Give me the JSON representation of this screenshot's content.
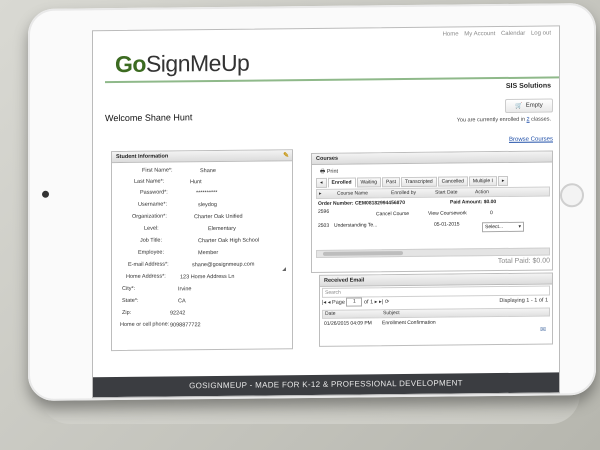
{
  "topnav": {
    "home": "Home",
    "my_account": "My Account",
    "calendar": "Calendar",
    "logout": "Log out"
  },
  "logo": {
    "go": "Go",
    "rest": "SignMeUp"
  },
  "org_name": "SIS Solutions",
  "cart": {
    "label": "Empty"
  },
  "welcome": "Welcome Shane Hunt",
  "enrolled": {
    "prefix": "You are currently enrolled in ",
    "count": "2",
    "suffix": " classes."
  },
  "browse_courses": "Browse Courses",
  "student_info": {
    "title": "Student Information",
    "fields": [
      {
        "label": "First Name*:",
        "value": "Shane"
      },
      {
        "label": "Last Name*:",
        "value": "Hunt"
      },
      {
        "label": "Password*:",
        "value": "**********"
      },
      {
        "label": "Username*:",
        "value": "sleydog"
      },
      {
        "label": "Organization*:",
        "value": "Charter Oak Unified"
      },
      {
        "label": "Level:",
        "value": "Elementary"
      },
      {
        "label": "Job Title:",
        "value": "Charter Oak High School"
      },
      {
        "label": "Employee:",
        "value": "Member"
      },
      {
        "label": "E-mail Address*:",
        "value": "shane@gosignmeup.com"
      },
      {
        "label": "Home Address*:",
        "value": "123 Home Address Ln"
      },
      {
        "label": "City*:",
        "value": "Irvine"
      },
      {
        "label": "State*:",
        "value": "CA"
      },
      {
        "label": "Zip:",
        "value": "92242"
      },
      {
        "label": "Home or cell phone:",
        "value": "9098877722"
      }
    ]
  },
  "courses": {
    "title": "Courses",
    "print": "Print",
    "tabs": [
      "Enrolled",
      "Waiting",
      "Past",
      "Transcripted",
      "Cancelled",
      "Multiple I"
    ],
    "columns": [
      "Course Name",
      "Enrolled by",
      "Start Date",
      "Action"
    ],
    "order_number": "Order Number: CEM08182994456870",
    "paid_amount": "Paid Amount: $0.00",
    "row1_id": "2596",
    "cancel_course": "Cancel Course",
    "view_coursework": "View Coursework",
    "row1_action": "0",
    "row2_id": "2503",
    "row2_name": "Understanding Te...",
    "row2_date": "05-01-2015",
    "row2_select": "Select...",
    "total_paid": "Total Paid: $0.00"
  },
  "email": {
    "title": "Received Email",
    "search_placeholder": "Search",
    "page_label": "Page",
    "page_value": "1",
    "of_pages": "of 1",
    "displaying": "Displaying 1 - 1 of 1",
    "columns": [
      "Date",
      "Subject"
    ],
    "row_date": "01/26/2015 04:09 PM",
    "row_subject": "Enrollment Confirmation"
  },
  "footer": "GOSIGNMEUP - MADE FOR K-12 & PROFESSIONAL DEVELOPMENT",
  "colors": {
    "brand_green": "#3c6b21",
    "footer_bg": "#3b3d41",
    "link": "#1f4fa8"
  }
}
